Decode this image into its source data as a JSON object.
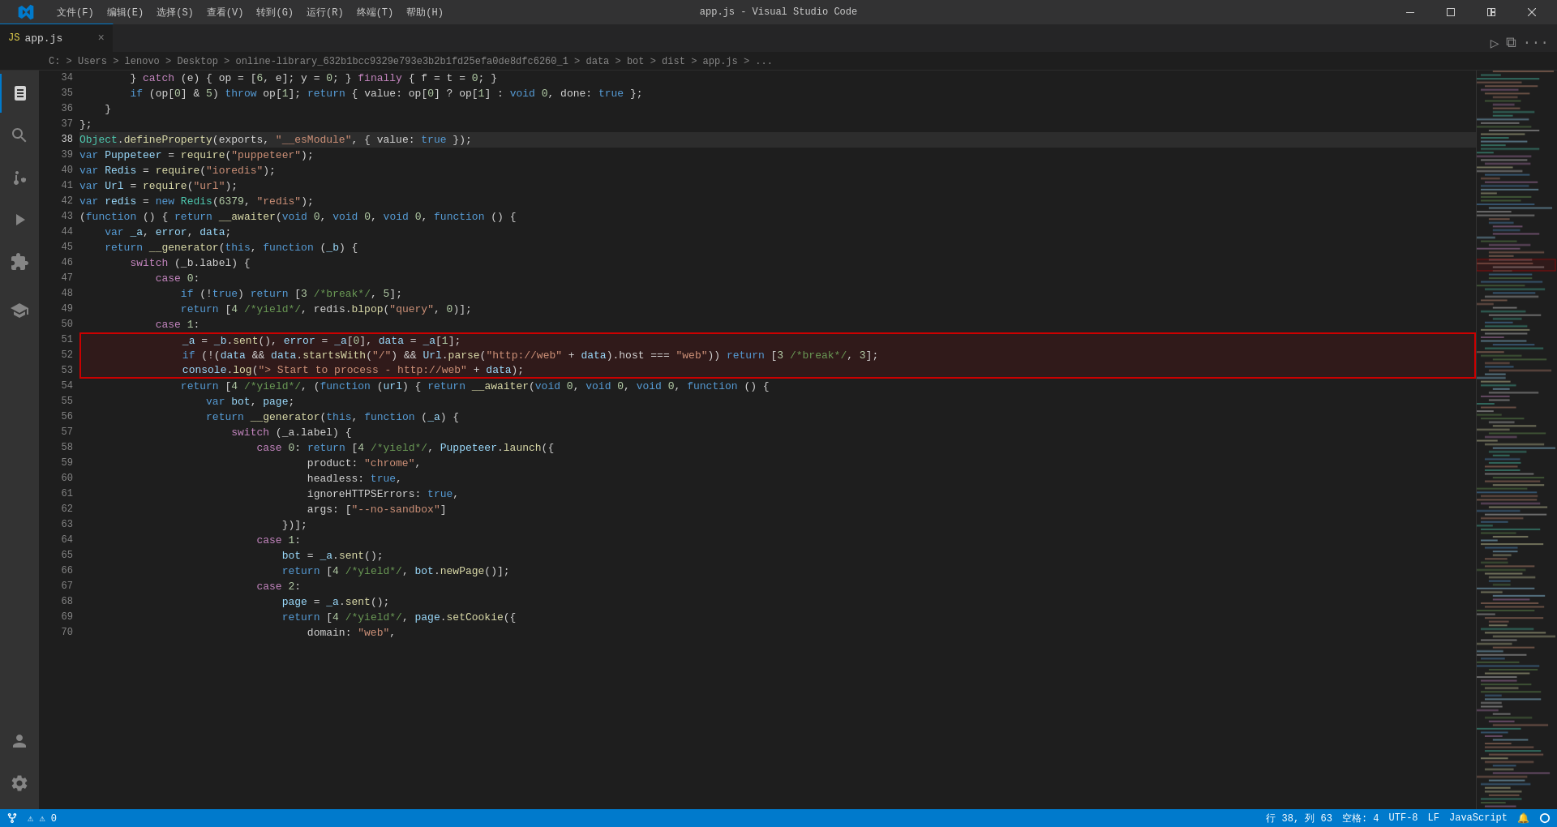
{
  "titlebar": {
    "title": "app.js - Visual Studio Code",
    "menus": [
      "文件(F)",
      "编辑(E)",
      "选择(S)",
      "查看(V)",
      "转到(G)",
      "运行(R)",
      "终端(T)",
      "帮助(H)"
    ]
  },
  "tab": {
    "icon": "JS",
    "name": "app.js",
    "close": "×"
  },
  "breadcrumb": {
    "path": "C: > Users > lenovo > Desktop > online-library_632b1bcc9329e793e3b2b1fd25efa0de8dfc6260_1 > data > bot > dist > app.js > ..."
  },
  "statusbar": {
    "errors": "⚠ 0",
    "warnings": "△ 0",
    "line": "行 38, 列 63",
    "spaces": "空格: 4",
    "encoding": "UTF-8",
    "eol": "LF",
    "language": "JavaScript",
    "feedback": "🔔",
    "branch": ""
  },
  "lines": [
    {
      "num": 34,
      "content": "        } catch (e) { op = [6, e]; y = 0; } finally { f = t = 0; }"
    },
    {
      "num": 35,
      "content": "        if (op[0] & 5) throw op[1]; return { value: op[0] ? op[1] : void 0, done: true };"
    },
    {
      "num": 36,
      "content": "    }"
    },
    {
      "num": 37,
      "content": "};"
    },
    {
      "num": 38,
      "content": "Object.defineProperty(exports, \"__esModule\", { value: true });",
      "active": true
    },
    {
      "num": 39,
      "content": "var Puppeteer = require(\"puppeteer\");"
    },
    {
      "num": 40,
      "content": "var Redis = require(\"ioredis\");"
    },
    {
      "num": 41,
      "content": "var Url = require(\"url\");"
    },
    {
      "num": 42,
      "content": "var redis = new Redis(6379, \"redis\");"
    },
    {
      "num": 43,
      "content": "(function () { return __awaiter(void 0, void 0, void 0, function () {"
    },
    {
      "num": 44,
      "content": "    var _a, error, data;"
    },
    {
      "num": 45,
      "content": "    return __generator(this, function (_b) {"
    },
    {
      "num": 46,
      "content": "        switch (_b.label) {"
    },
    {
      "num": 47,
      "content": "            case 0:"
    },
    {
      "num": 48,
      "content": "                if (!true) return [3 /*break*/, 5];"
    },
    {
      "num": 49,
      "content": "                return [4 /*yield*/, redis.blpop(\"query\", 0)];"
    },
    {
      "num": 50,
      "content": "            case 1:"
    },
    {
      "num": 51,
      "content": "                _a = _b.sent(), error = _a[0], data = _a[1];",
      "redbox": "top"
    },
    {
      "num": 52,
      "content": "                if (!(data && data.startsWith(\"/\") && Url.parse(\"http://web\" + data).host === \"web\")) return [3 /*break*/, 3];",
      "redbox": "mid"
    },
    {
      "num": 53,
      "content": "                console.log(\"> Start to process - http://web\" + data);",
      "redbox": "bottom"
    },
    {
      "num": 54,
      "content": "                return [4 /*yield*/, (function (url) { return __awaiter(void 0, void 0, void 0, function () {"
    },
    {
      "num": 55,
      "content": "                    var bot, page;"
    },
    {
      "num": 56,
      "content": "                    return __generator(this, function (_a) {"
    },
    {
      "num": 57,
      "content": "                        switch (_a.label) {"
    },
    {
      "num": 58,
      "content": "                            case 0: return [4 /*yield*/, Puppeteer.launch({"
    },
    {
      "num": 59,
      "content": "                                    product: \"chrome\","
    },
    {
      "num": 60,
      "content": "                                    headless: true,"
    },
    {
      "num": 61,
      "content": "                                    ignoreHTTPSErrors: true,"
    },
    {
      "num": 62,
      "content": "                                    args: [\"--no-sandbox\"]"
    },
    {
      "num": 63,
      "content": "                                })];"
    },
    {
      "num": 64,
      "content": "                            case 1:"
    },
    {
      "num": 65,
      "content": "                                bot = _a.sent();"
    },
    {
      "num": 66,
      "content": "                                return [4 /*yield*/, bot.newPage()];"
    },
    {
      "num": 67,
      "content": "                            case 2:"
    },
    {
      "num": 68,
      "content": "                                page = _a.sent();"
    },
    {
      "num": 69,
      "content": "                                return [4 /*yield*/, page.setCookie({"
    },
    {
      "num": 70,
      "content": "                                    domain: \"web\","
    }
  ]
}
